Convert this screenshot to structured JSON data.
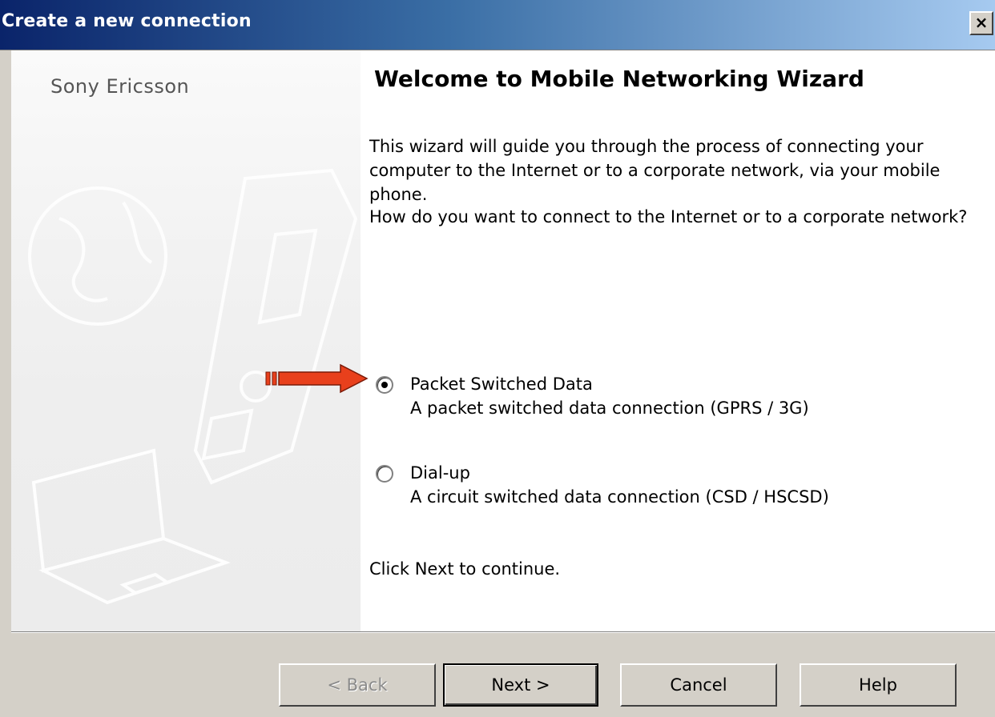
{
  "window": {
    "title": "Create a new connection",
    "close_glyph": "×",
    "titlebar_colors": [
      "#0a246a",
      "#3a6ea5",
      "#a6caf0"
    ]
  },
  "side_panel": {
    "brand": "Sony Ericsson",
    "illustration": [
      "globe-icon",
      "phone-icon",
      "laptop-icon"
    ]
  },
  "main": {
    "title": "Welcome to Mobile Networking Wizard",
    "intro": "This wizard will guide you through the process of connecting your computer to the Internet or to a corporate network, via your mobile phone.",
    "question": "How do you want to connect to the Internet or to a corporate network?",
    "options": [
      {
        "label": "Packet Switched Data",
        "description": "A packet switched data connection (GPRS / 3G)",
        "selected": true
      },
      {
        "label": "Dial-up",
        "description": "A circuit switched data connection (CSD / HSCSD)",
        "selected": false
      }
    ],
    "continue_text": "Click Next to continue."
  },
  "annotation": {
    "icon": "red-arrow-icon",
    "color": "#e8401c"
  },
  "buttons": {
    "back": "< Back",
    "next": "Next >",
    "cancel": "Cancel",
    "help": "Help"
  }
}
